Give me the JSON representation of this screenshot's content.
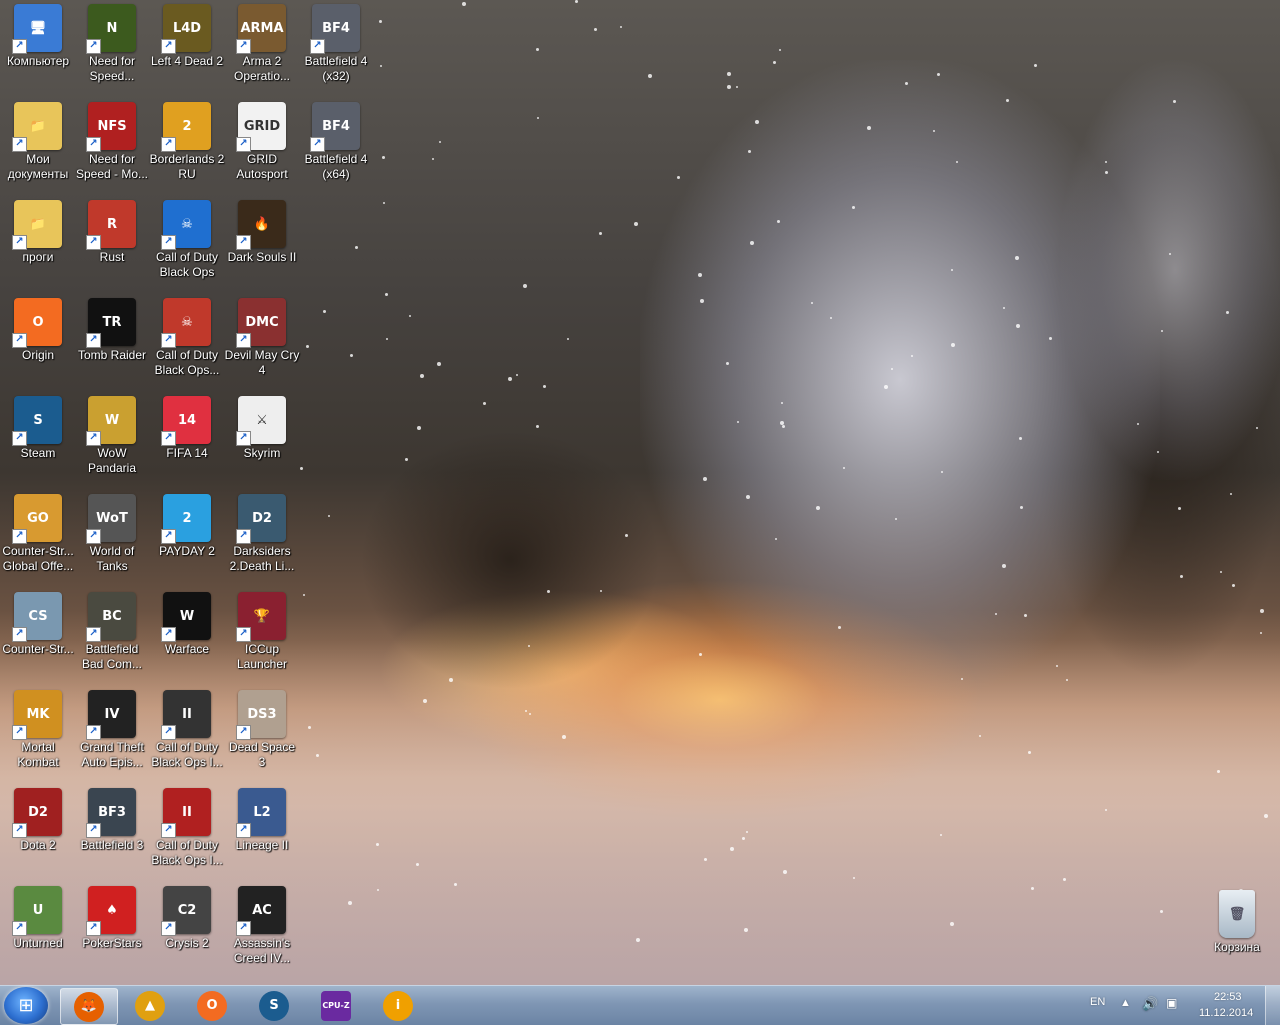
{
  "desktop": {
    "icons": [
      {
        "label": "Компьютер",
        "color": "#3a7bd5",
        "glyph": "🖥"
      },
      {
        "label": "Need for Speed...",
        "color": "#3c5a1e",
        "glyph": "N"
      },
      {
        "label": "Left 4 Dead 2",
        "color": "#6a5a20",
        "glyph": "L4D"
      },
      {
        "label": "Arma 2 Operatio...",
        "color": "#7a5a30",
        "glyph": "ARMA"
      },
      {
        "label": "Battlefield 4 (x32)",
        "color": "#5a5f6a",
        "glyph": "BF4"
      },
      {
        "label": "Мои документы",
        "color": "#e8c55a",
        "glyph": "📁"
      },
      {
        "label": "Need for Speed - Mo...",
        "color": "#b02020",
        "glyph": "NFS"
      },
      {
        "label": "Borderlands 2 RU",
        "color": "#e0a020",
        "glyph": "2"
      },
      {
        "label": "GRID Autosport",
        "color": "#f2f2f2",
        "glyph": "GRID"
      },
      {
        "label": "Battlefield 4 (x64)",
        "color": "#5a5f6a",
        "glyph": "BF4"
      },
      {
        "label": "проги",
        "color": "#e8c55a",
        "glyph": "📁"
      },
      {
        "label": "Rust",
        "color": "#c0392b",
        "glyph": "R"
      },
      {
        "label": "Call of Duty Black Ops",
        "color": "#1f6fd0",
        "glyph": "☠"
      },
      {
        "label": "Dark Souls II",
        "color": "#3a2a1a",
        "glyph": "🔥"
      },
      {
        "label": "",
        "color": "",
        "glyph": ""
      },
      {
        "label": "Origin",
        "color": "#f36b21",
        "glyph": "O"
      },
      {
        "label": "Tomb Raider",
        "color": "#111111",
        "glyph": "TR"
      },
      {
        "label": "Call of Duty Black Ops...",
        "color": "#c0392b",
        "glyph": "☠"
      },
      {
        "label": "Devil May Cry 4",
        "color": "#8a3030",
        "glyph": "DMC"
      },
      {
        "label": "",
        "color": "",
        "glyph": ""
      },
      {
        "label": "Steam",
        "color": "#1b5c8f",
        "glyph": "S"
      },
      {
        "label": "WoW Pandaria",
        "color": "#caa030",
        "glyph": "W"
      },
      {
        "label": "FIFA 14",
        "color": "#e03040",
        "glyph": "14"
      },
      {
        "label": "Skyrim",
        "color": "#eeeeee",
        "glyph": "⚔"
      },
      {
        "label": "",
        "color": "",
        "glyph": ""
      },
      {
        "label": "Counter-Str... Global Offe...",
        "color": "#d89a30",
        "glyph": "GO"
      },
      {
        "label": "World of Tanks",
        "color": "#555555",
        "glyph": "WoT"
      },
      {
        "label": "PAYDAY 2",
        "color": "#2aa0e0",
        "glyph": "2"
      },
      {
        "label": "Darksiders 2.Death Li...",
        "color": "#3a5a70",
        "glyph": "D2"
      },
      {
        "label": "",
        "color": "",
        "glyph": ""
      },
      {
        "label": "Counter-Str...",
        "color": "#7a98b0",
        "glyph": "CS"
      },
      {
        "label": "Battlefield Bad Com...",
        "color": "#4a4a40",
        "glyph": "BC"
      },
      {
        "label": "Warface",
        "color": "#111111",
        "glyph": "W"
      },
      {
        "label": "ICCup Launcher",
        "color": "#8a2030",
        "glyph": "🏆"
      },
      {
        "label": "",
        "color": "",
        "glyph": ""
      },
      {
        "label": "Mortal Kombat",
        "color": "#d09020",
        "glyph": "MK"
      },
      {
        "label": "Grand Theft Auto Epis...",
        "color": "#222222",
        "glyph": "IV"
      },
      {
        "label": "Call of Duty Black Ops I...",
        "color": "#333333",
        "glyph": "II"
      },
      {
        "label": "Dead Space 3",
        "color": "#b0a090",
        "glyph": "DS3"
      },
      {
        "label": "",
        "color": "",
        "glyph": ""
      },
      {
        "label": "Dota 2",
        "color": "#a02020",
        "glyph": "D2"
      },
      {
        "label": "Battlefield 3",
        "color": "#3a4550",
        "glyph": "BF3"
      },
      {
        "label": "Call of Duty Black Ops I...",
        "color": "#b02020",
        "glyph": "II"
      },
      {
        "label": "Lineage II",
        "color": "#3a5a90",
        "glyph": "L2"
      },
      {
        "label": "",
        "color": "",
        "glyph": ""
      },
      {
        "label": "Unturned",
        "color": "#5a8a40",
        "glyph": "U"
      },
      {
        "label": "PokerStars",
        "color": "#d02020",
        "glyph": "♠"
      },
      {
        "label": "Crysis 2",
        "color": "#444444",
        "glyph": "C2"
      },
      {
        "label": "Assassin's Creed IV...",
        "color": "#222222",
        "glyph": "AC"
      }
    ],
    "recycle_bin": {
      "label": "Корзина"
    }
  },
  "taskbar": {
    "pinned": [
      {
        "name": "firefox",
        "glyph": "🦊",
        "color": "#e66000",
        "active": true
      },
      {
        "name": "app-triangle",
        "glyph": "▲",
        "color": "#e0a010",
        "active": false
      },
      {
        "name": "origin",
        "glyph": "O",
        "color": "#f36b21",
        "active": false
      },
      {
        "name": "steam",
        "glyph": "S",
        "color": "#1b5c8f",
        "active": false
      },
      {
        "name": "cpu-z",
        "glyph": "CPU-Z",
        "color": "#6a2aa0",
        "active": false
      },
      {
        "name": "info",
        "glyph": "i",
        "color": "#f0a000",
        "active": false
      }
    ],
    "tray": {
      "language": "EN",
      "time": "22:53",
      "date": "11.12.2014"
    }
  }
}
